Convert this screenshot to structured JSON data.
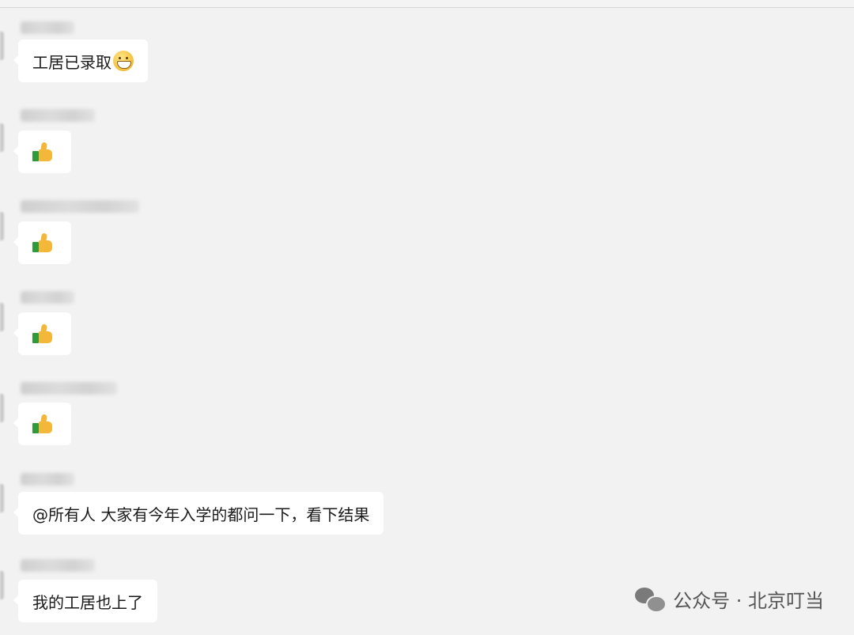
{
  "messages": [
    {
      "text": "工居已录取",
      "emoji": "grin-icon"
    },
    {
      "emoji": "thumbs-up-icon"
    },
    {
      "emoji": "thumbs-up-icon"
    },
    {
      "emoji": "thumbs-up-icon"
    },
    {
      "emoji": "thumbs-up-icon"
    },
    {
      "text": "@所有人 大家有今年入学的都问一下，看下结果"
    },
    {
      "text": "我的工居也上了"
    }
  ],
  "watermark": {
    "text": "公众号 · 北京叮当",
    "icon": "wechat-icon"
  }
}
